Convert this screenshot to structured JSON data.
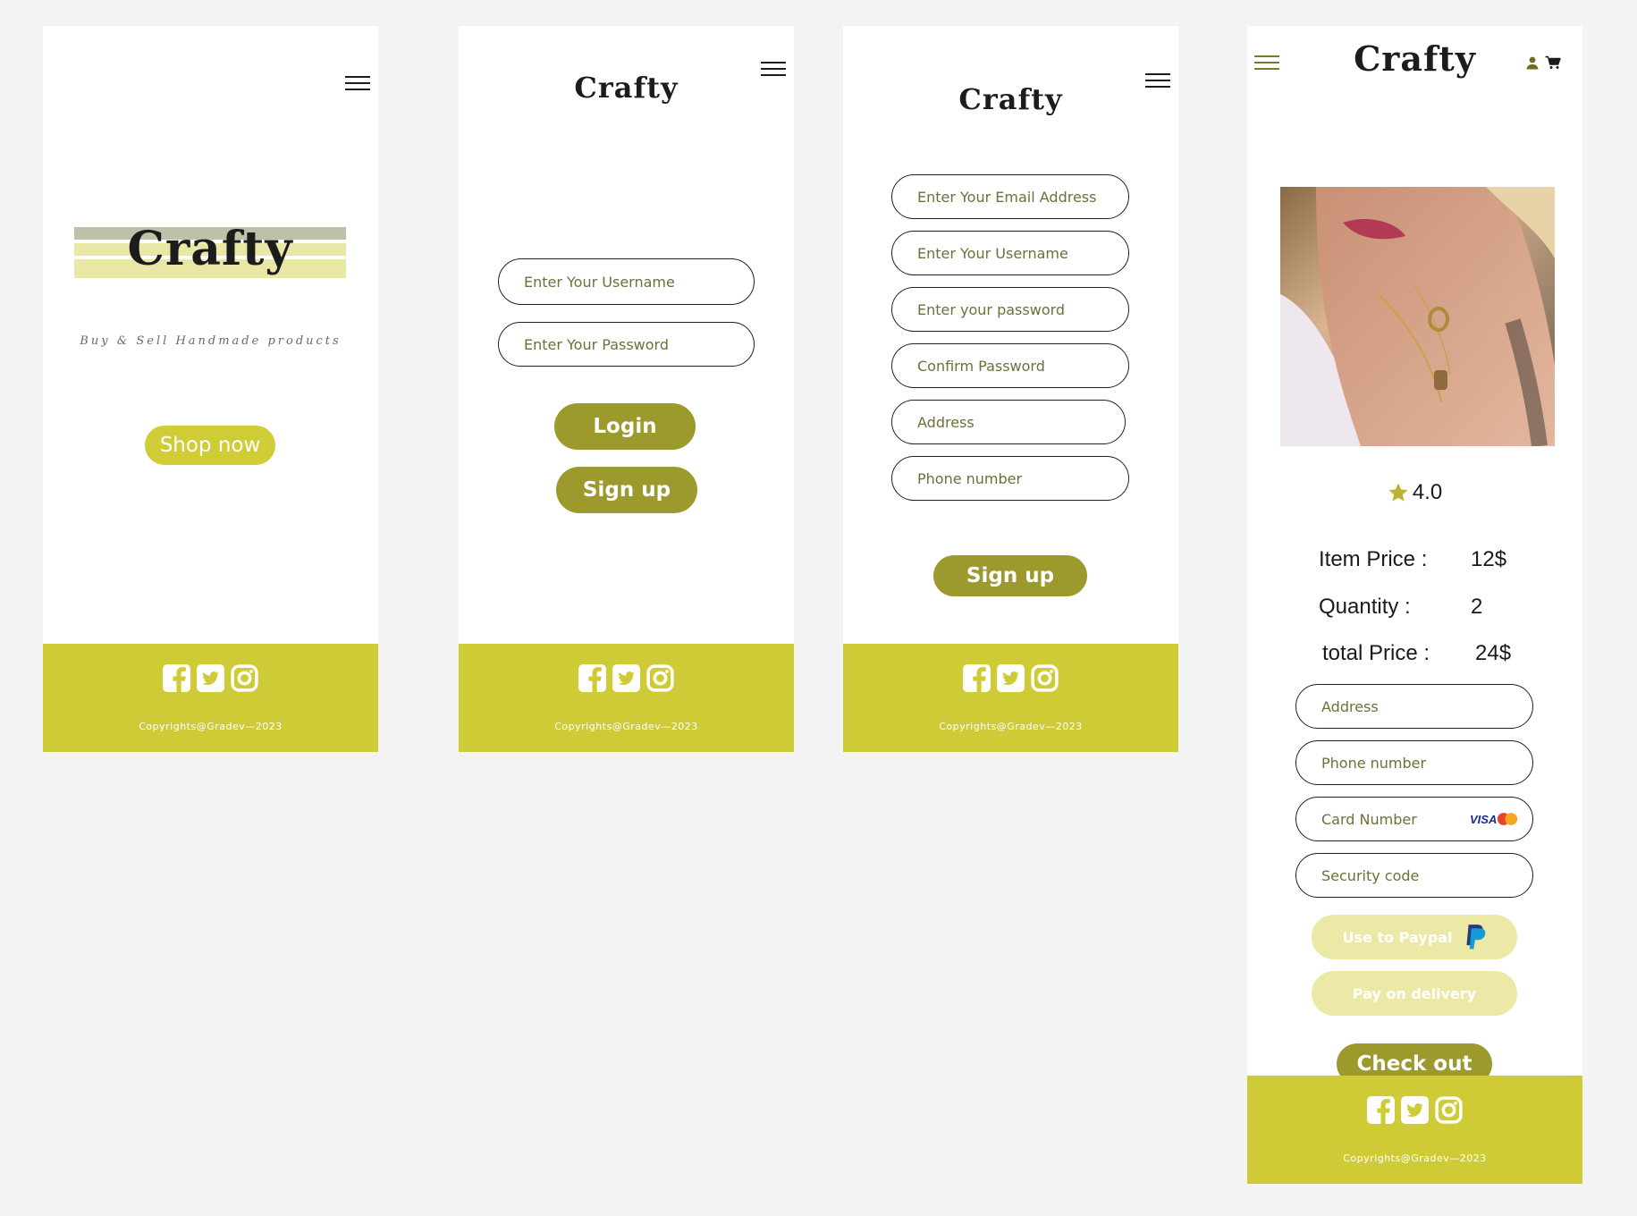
{
  "brand": "Crafty",
  "landing": {
    "tagline": "Buy & Sell Handmade products",
    "cta": "Shop now"
  },
  "login": {
    "username_placeholder": "Enter Your Username",
    "password_placeholder": "Enter Your Password",
    "login_label": "Login",
    "signup_label": "Sign up"
  },
  "signup": {
    "fields": [
      "Enter Your Email Address",
      "Enter Your Username",
      "Enter your password",
      "Confirm Password",
      "Address",
      "Phone number"
    ],
    "signup_label": "Sign up"
  },
  "checkout": {
    "rating": "4.0",
    "item_price_label": "Item Price :",
    "item_price_value": "12$",
    "quantity_label": "Quantity :",
    "quantity_value": "2",
    "total_label": "total Price :",
    "total_value": "24$",
    "address_placeholder": "Address",
    "phone_placeholder": "Phone number",
    "card_placeholder": "Card Number",
    "security_placeholder": "Security code",
    "paypal_label": "Use to Paypal",
    "delivery_label": "Pay on delivery",
    "checkout_label": "Check out"
  },
  "footer": {
    "copyright": "Copyrights@Gradev—2023"
  },
  "icons": [
    "menu-icon",
    "facebook-icon",
    "twitter-icon",
    "instagram-icon",
    "user-icon",
    "cart-icon",
    "star-icon",
    "visa-icon",
    "mastercard-icon",
    "paypal-icon"
  ],
  "colors": {
    "olive_dark": "#9c9a2c",
    "olive_bright": "#cfcb36",
    "olive_pale": "#ece9a6"
  }
}
